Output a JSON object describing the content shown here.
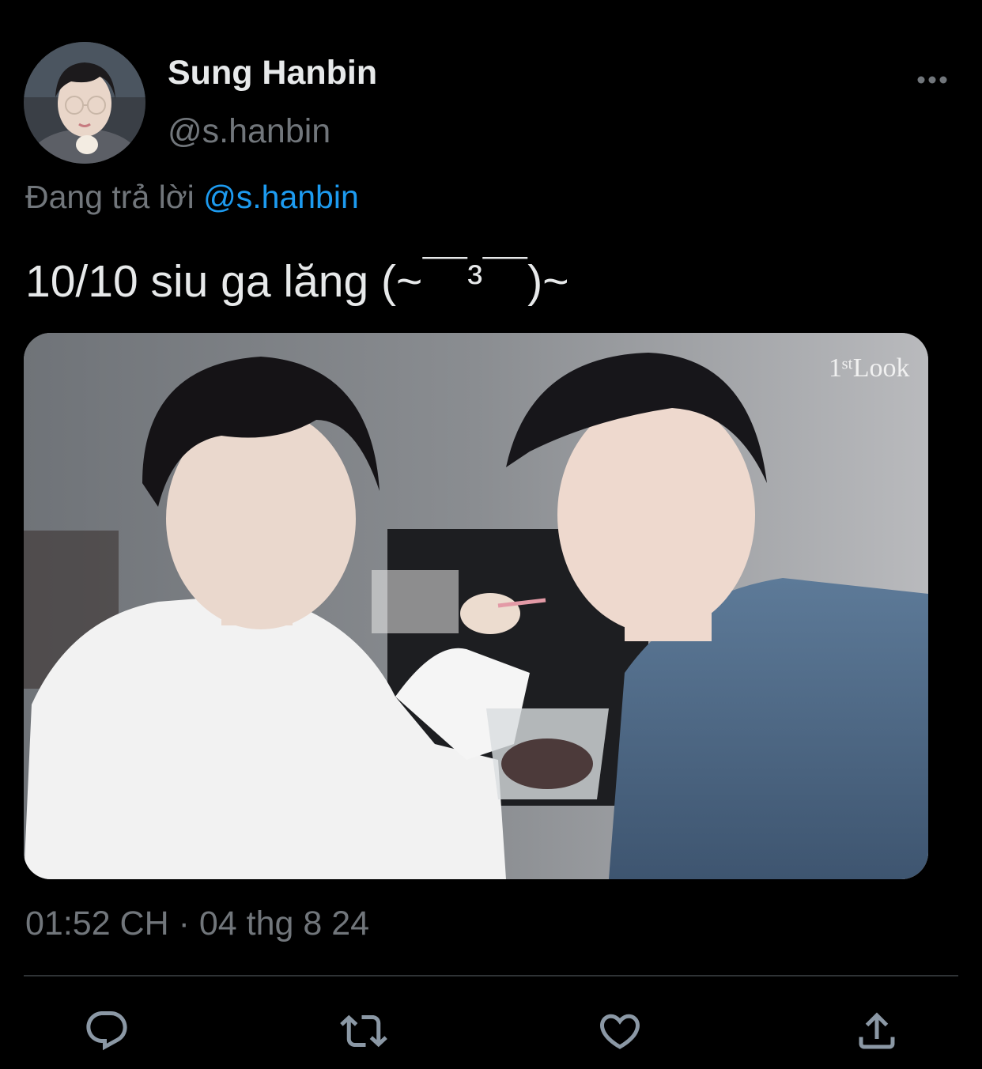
{
  "tweet": {
    "author": {
      "display_name": "Sung Hanbin",
      "handle": "@s.hanbin"
    },
    "reply_prefix": "Đang trả lời ",
    "reply_to": "@s.hanbin",
    "text": "10/10 siu ga lăng (~￣³￣)~",
    "media_watermark": "1ˢᵗLook",
    "timestamp": "01:52 CH · 04 thg 8 24"
  },
  "actions": [
    {
      "name": "reply",
      "icon": "reply-icon"
    },
    {
      "name": "retweet",
      "icon": "retweet-icon"
    },
    {
      "name": "like",
      "icon": "heart-icon"
    },
    {
      "name": "share",
      "icon": "share-icon"
    }
  ],
  "colors": {
    "background": "#000000",
    "text_primary": "#e7e9ea",
    "text_secondary": "#71767b",
    "accent": "#1d9bf0",
    "divider": "#2f3336"
  }
}
